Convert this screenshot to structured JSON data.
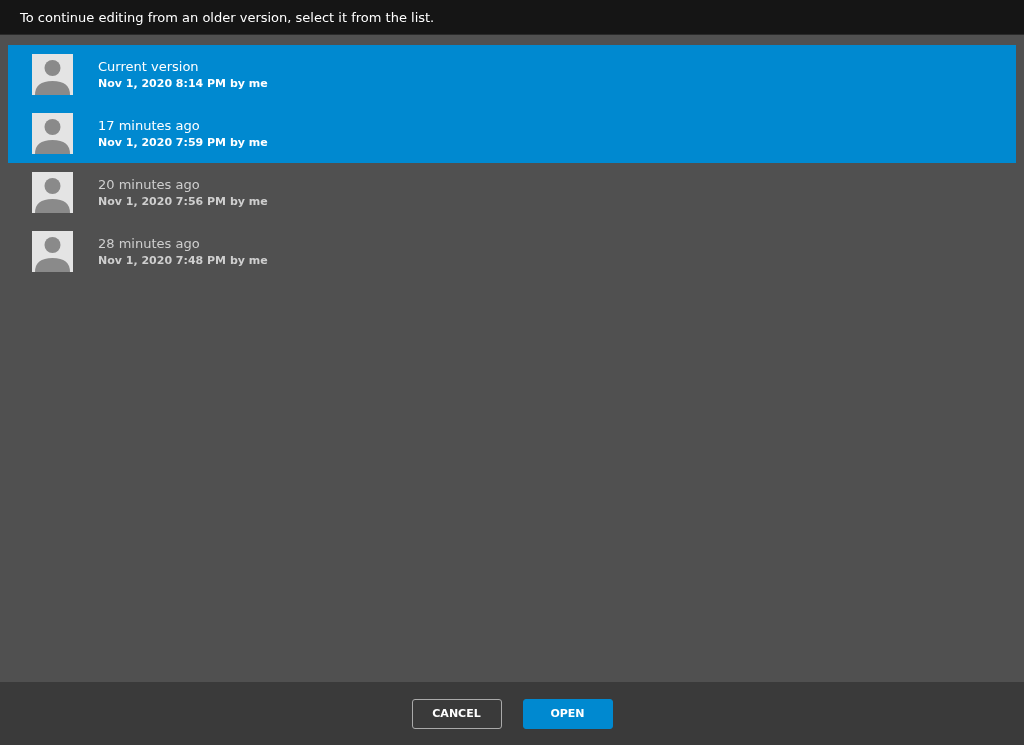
{
  "header": {
    "instruction": "To continue editing from an older version, select it from the list."
  },
  "versions": [
    {
      "title": "Current version",
      "detail": "Nov 1, 2020 8:14 PM by me",
      "selected": true
    },
    {
      "title": "17 minutes ago",
      "detail": "Nov 1, 2020 7:59 PM by me",
      "selected": true
    },
    {
      "title": "20 minutes ago",
      "detail": "Nov 1, 2020 7:56 PM by me",
      "selected": false
    },
    {
      "title": "28 minutes ago",
      "detail": "Nov 1, 2020 7:48 PM by me",
      "selected": false
    }
  ],
  "buttons": [
    {
      "label": "CANCEL",
      "kind": "secondary"
    },
    {
      "label": "OPEN",
      "kind": "primary"
    }
  ]
}
